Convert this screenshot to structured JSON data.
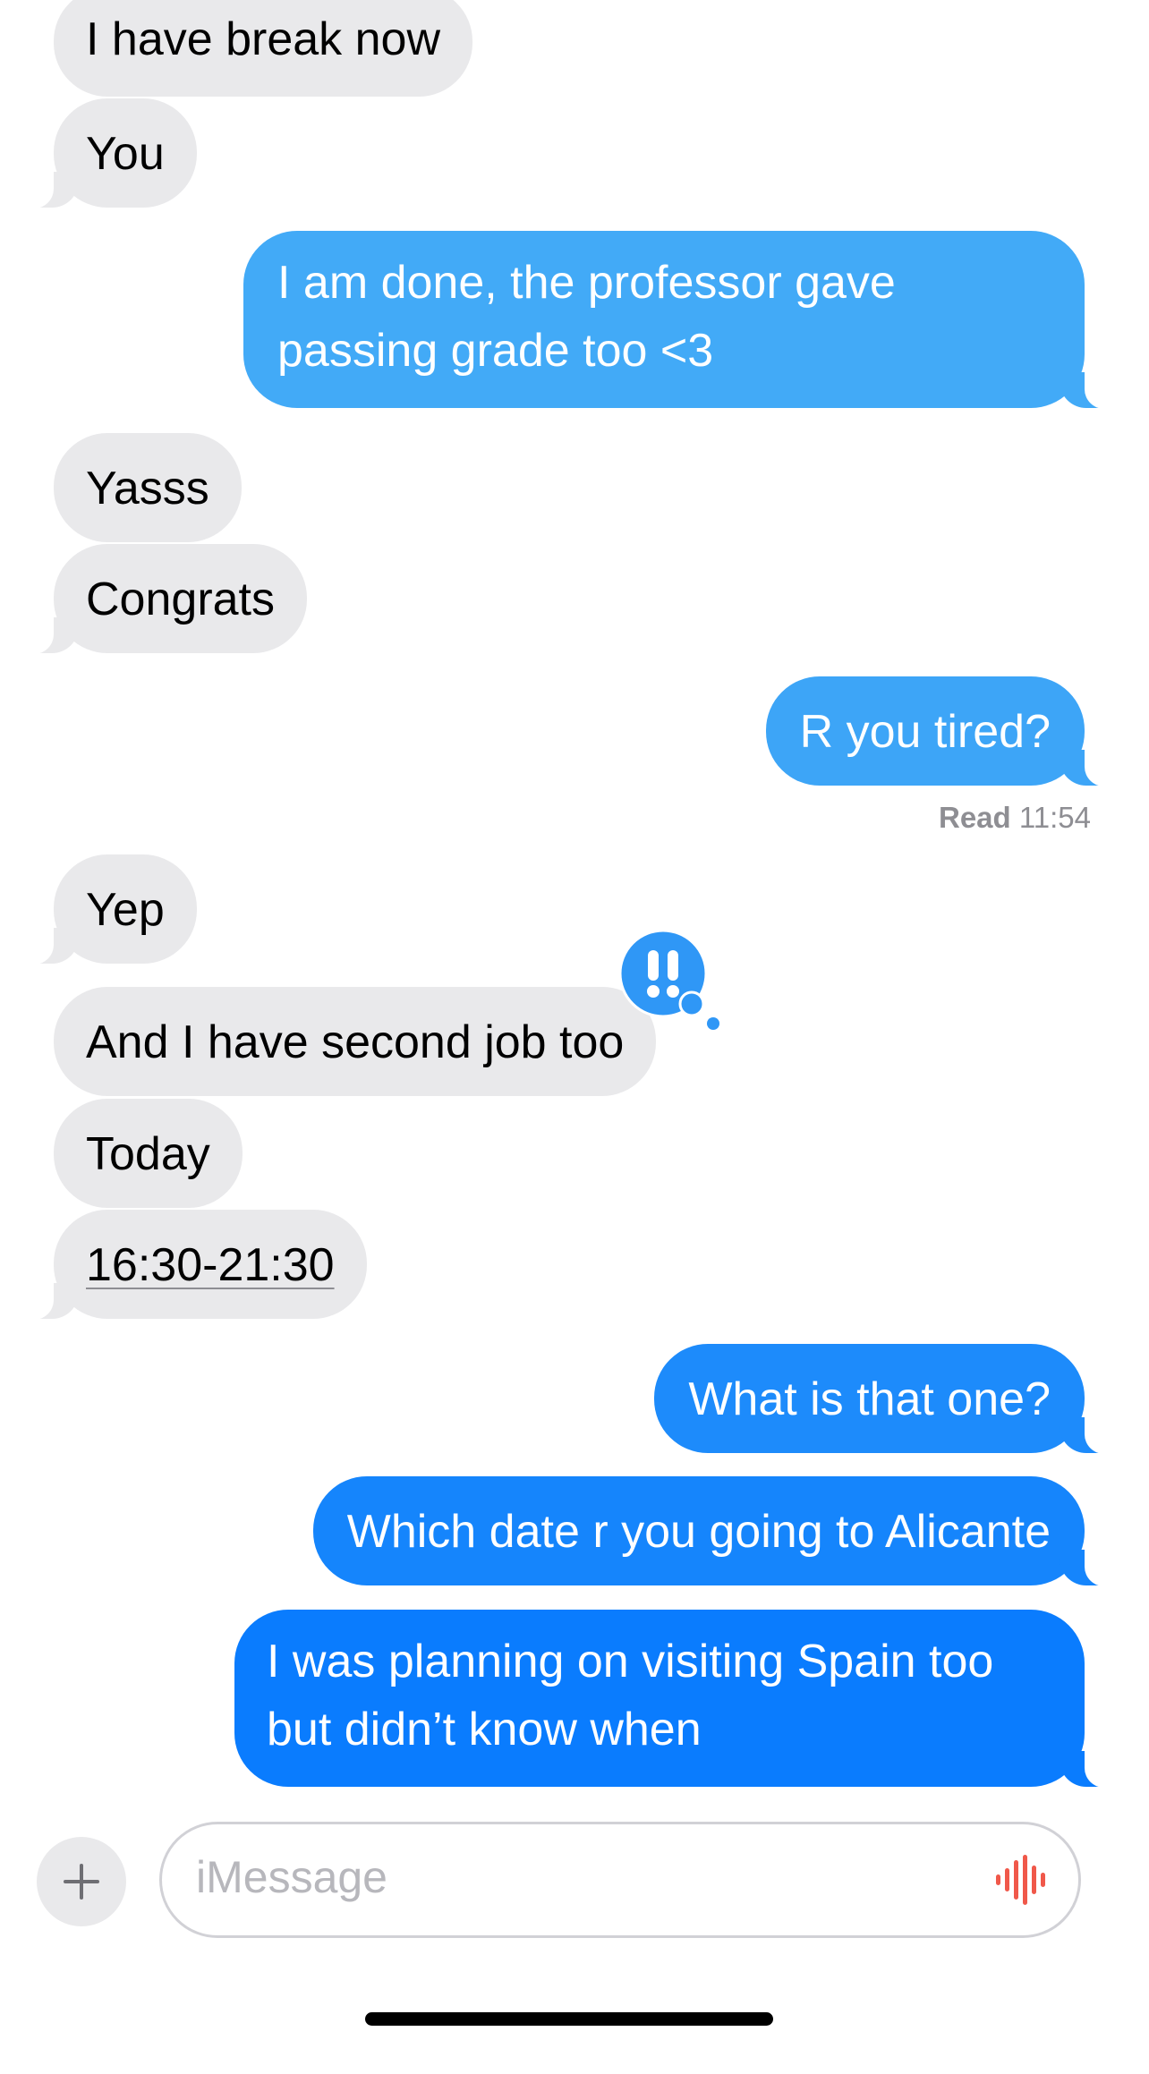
{
  "messages": [
    {
      "text": "I have break now",
      "from": "them"
    },
    {
      "text": "You",
      "from": "them"
    },
    {
      "text": "I am done, the professor gave passing grade too <3",
      "from": "me"
    },
    {
      "text": "Yasss",
      "from": "them"
    },
    {
      "text": "Congrats",
      "from": "them"
    },
    {
      "text": "R you tired?",
      "from": "me"
    },
    {
      "text": "Yep",
      "from": "them"
    },
    {
      "text": "And I have second job too",
      "from": "them",
      "tapback": "exclamation"
    },
    {
      "text": "Today",
      "from": "them"
    },
    {
      "text": "16:30-21:30",
      "from": "them",
      "detected_link": true
    },
    {
      "text": "What is that one?",
      "from": "me"
    },
    {
      "text": "Which date r you going to Alicante",
      "from": "me"
    },
    {
      "text": "I was planning on visiting Spain too but didn’t know when",
      "from": "me"
    }
  ],
  "read_receipt": {
    "label": "Read",
    "time": "11:54"
  },
  "input": {
    "placeholder": "iMessage"
  },
  "icons": {
    "plus": "plus-icon",
    "audio": "audio-waveform-icon",
    "tapback": "double-exclamation-icon"
  },
  "colors": {
    "incoming_bubble": "#e9e9eb",
    "outgoing_gradient_top": "#42aaf7",
    "outgoing_gradient_mid": "#2b93f9",
    "outgoing_gradient_bottom": "#0a7cfe",
    "audio_icon": "#f0584a",
    "read_receipt": "#8e8e93"
  }
}
